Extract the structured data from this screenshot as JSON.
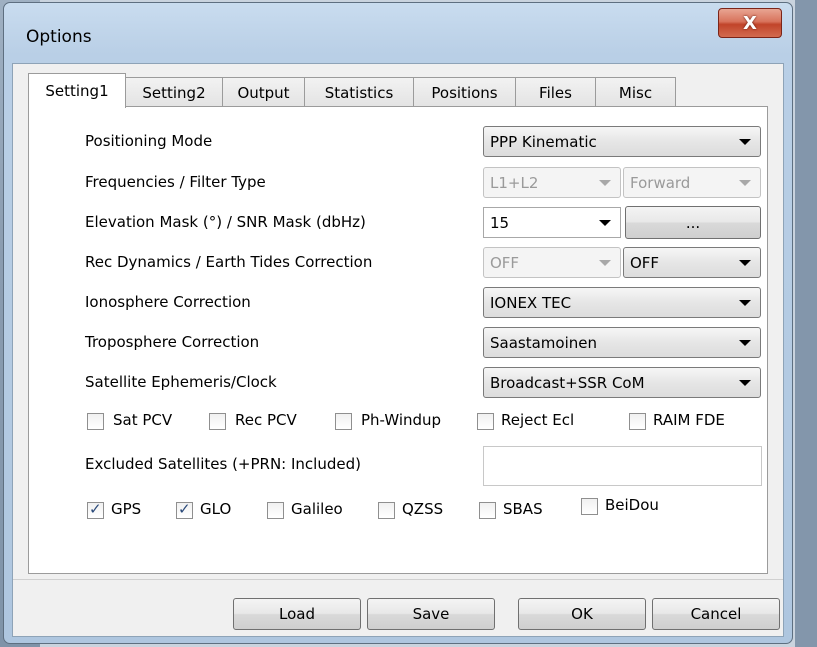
{
  "window": {
    "title": "Options",
    "close_glyph": "X"
  },
  "tabs": [
    "Setting1",
    "Setting2",
    "Output",
    "Statistics",
    "Positions",
    "Files",
    "Misc"
  ],
  "rows": {
    "positioning_mode": {
      "label": "Positioning Mode",
      "value": "PPP Kinematic"
    },
    "frequencies": {
      "label": "Frequencies / Filter Type",
      "value1": "L1+L2",
      "value2": "Forward"
    },
    "elevation": {
      "label": "Elevation Mask (°) / SNR Mask (dbHz)",
      "value": "15",
      "button": "..."
    },
    "rec_dynamics": {
      "label": "Rec Dynamics / Earth Tides Correction",
      "value1": "OFF",
      "value2": "OFF"
    },
    "ionosphere": {
      "label": "Ionosphere Correction",
      "value": "IONEX TEC"
    },
    "troposphere": {
      "label": "Troposphere Correction",
      "value": "Saastamoinen"
    },
    "ephemeris": {
      "label": "Satellite Ephemeris/Clock",
      "value": "Broadcast+SSR CoM"
    }
  },
  "options": {
    "sat_pcv": "Sat PCV",
    "rec_pcv": "Rec PCV",
    "ph_windup": "Ph-Windup",
    "reject_ecl": "Reject Ecl",
    "raim_fde": "RAIM FDE"
  },
  "excluded": {
    "label": "Excluded Satellites (+PRN: Included)",
    "value": ""
  },
  "systems": {
    "gps": {
      "label": "GPS",
      "checked": true
    },
    "glo": {
      "label": "GLO",
      "checked": true
    },
    "galileo": {
      "label": "Galileo",
      "checked": false
    },
    "qzss": {
      "label": "QZSS",
      "checked": false
    },
    "sbas": {
      "label": "SBAS",
      "checked": false
    },
    "beidou": {
      "label": "BeiDou",
      "checked": false
    }
  },
  "buttons": {
    "load": "Load",
    "save": "Save",
    "ok": "OK",
    "cancel": "Cancel"
  }
}
